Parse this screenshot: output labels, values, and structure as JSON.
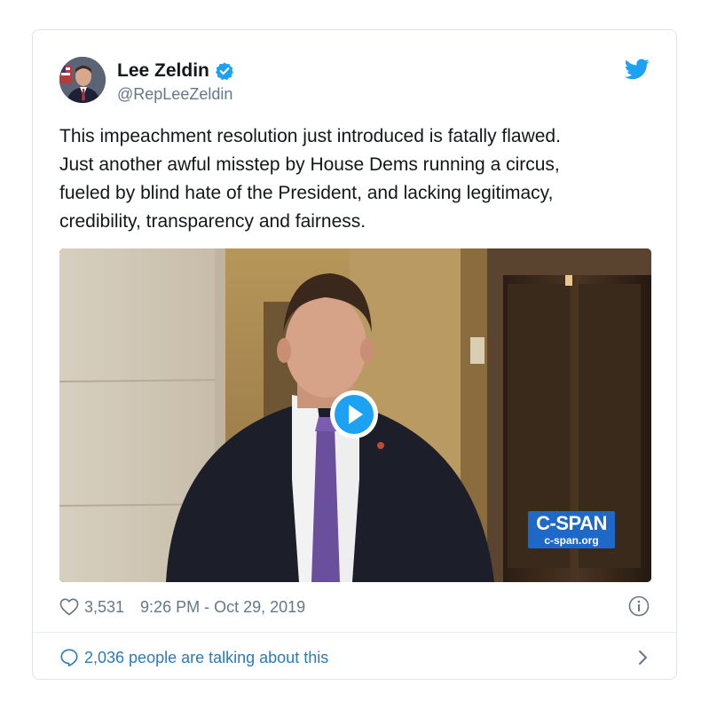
{
  "tweet": {
    "display_name": "Lee Zeldin",
    "handle": "@RepLeeZeldin",
    "verified": true,
    "text_lines": [
      "This impeachment resolution just introduced is fatally flawed.",
      "Just another awful misstep by House Dems running a circus,",
      "fueled by blind hate of the President, and lacking legitimacy,",
      "credibility, transparency and fairness."
    ],
    "likes": "3,531",
    "timestamp": "9:26 PM - Oct 29, 2019",
    "conversation": "2,036 people are talking about this"
  },
  "media": {
    "type": "video",
    "watermark_main": "C-SPAN",
    "watermark_sub": "c-span.org"
  },
  "icons": {
    "verified": "verified-badge-icon",
    "platform": "twitter-bird-icon",
    "like": "heart-icon",
    "info": "info-icon",
    "reply": "comment-bubble-icon",
    "more": "chevron-right-icon",
    "play": "play-icon"
  },
  "colors": {
    "accent": "#1da1f2",
    "link": "#2b7bb9",
    "text": "#14171a",
    "muted": "#657786",
    "cspan_blue": "#1e68c8"
  }
}
